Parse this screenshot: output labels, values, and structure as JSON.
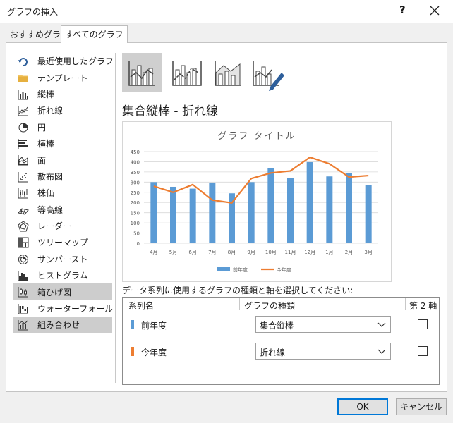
{
  "window": {
    "title": "グラフの挿入",
    "help_label": "?"
  },
  "tabs": [
    {
      "label": "おすすめグラフ",
      "active": false
    },
    {
      "label": "すべてのグラフ",
      "active": true
    }
  ],
  "sidebar": {
    "items": [
      {
        "label": "最近使用したグラフ",
        "icon": "recent-icon"
      },
      {
        "label": "テンプレート",
        "icon": "folder-icon"
      },
      {
        "label": "縦棒",
        "icon": "column-chart-icon"
      },
      {
        "label": "折れ線",
        "icon": "line-chart-icon"
      },
      {
        "label": "円",
        "icon": "pie-chart-icon"
      },
      {
        "label": "横棒",
        "icon": "bar-chart-icon"
      },
      {
        "label": "面",
        "icon": "area-chart-icon"
      },
      {
        "label": "散布図",
        "icon": "scatter-chart-icon"
      },
      {
        "label": "株価",
        "icon": "stock-chart-icon"
      },
      {
        "label": "等高線",
        "icon": "surface-chart-icon"
      },
      {
        "label": "レーダー",
        "icon": "radar-chart-icon"
      },
      {
        "label": "ツリーマップ",
        "icon": "treemap-chart-icon"
      },
      {
        "label": "サンバースト",
        "icon": "sunburst-chart-icon"
      },
      {
        "label": "ヒストグラム",
        "icon": "histogram-chart-icon"
      },
      {
        "label": "箱ひげ図",
        "icon": "box-whisker-chart-icon"
      },
      {
        "label": "ウォーターフォール",
        "icon": "waterfall-chart-icon"
      },
      {
        "label": "組み合わせ",
        "icon": "combo-chart-icon"
      }
    ],
    "highlighted": [
      14,
      16
    ],
    "selected_index": 16
  },
  "subtypes": {
    "icons": [
      "combo-column-line-icon",
      "combo-column-line-secondary-icon",
      "combo-area-column-icon",
      "combo-custom-icon"
    ],
    "selected_index": 0
  },
  "heading": "集合縦棒 - 折れ線",
  "chart_data": {
    "type": "bar",
    "title": "グラフ タイトル",
    "categories": [
      "4月",
      "5月",
      "6月",
      "7月",
      "8月",
      "9月",
      "10月",
      "11月",
      "12月",
      "1月",
      "2月",
      "3月"
    ],
    "series": [
      {
        "name": "前年度",
        "type": "bar",
        "color": "#5b9bd5",
        "values": [
          300,
          277,
          268,
          298,
          245,
          300,
          368,
          320,
          398,
          328,
          345,
          287
        ]
      },
      {
        "name": "今年度",
        "type": "line",
        "color": "#ed7d31",
        "values": [
          280,
          250,
          288,
          212,
          198,
          318,
          345,
          355,
          422,
          390,
          325,
          332
        ]
      }
    ],
    "ylim": [
      0,
      450
    ],
    "yticks": [
      0,
      50,
      100,
      150,
      200,
      250,
      300,
      350,
      400,
      450
    ],
    "grid": true,
    "legend": "bottom"
  },
  "series_table": {
    "instruction": "データ系列に使用するグラフの種類と軸を選択してください:",
    "headers": {
      "name": "系列名",
      "type": "グラフの種類",
      "secondary": "第 2 軸"
    },
    "rows": [
      {
        "name": "前年度",
        "color": "#5b9bd5",
        "chart_type": "集合縦棒",
        "secondary_axis": false
      },
      {
        "name": "今年度",
        "color": "#ed7d31",
        "chart_type": "折れ線",
        "secondary_axis": false
      }
    ]
  },
  "buttons": {
    "ok": "OK",
    "cancel": "キャンセル"
  }
}
